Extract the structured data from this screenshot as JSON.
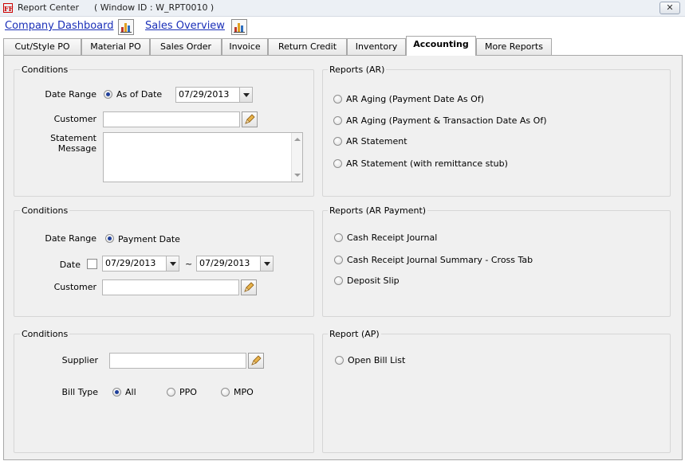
{
  "window": {
    "title": "Report Center",
    "window_id": "( Window ID : W_RPT0010 )",
    "app_icon": "FF",
    "close_icon": "✕"
  },
  "links": {
    "company_dashboard": "Company Dashboard",
    "sales_overview": "Sales Overview",
    "chart_icon": "bar-chart-icon"
  },
  "tabs": [
    {
      "label": "Cut/Style PO"
    },
    {
      "label": "Material PO"
    },
    {
      "label": "Sales Order"
    },
    {
      "label": "Invoice"
    },
    {
      "label": "Return Credit"
    },
    {
      "label": "Inventory"
    },
    {
      "label": "Accounting",
      "active": true
    },
    {
      "label": "More Reports"
    }
  ],
  "ar_conditions": {
    "title": "Conditions",
    "date_range_label": "Date Range",
    "date_range_option": "As of Date",
    "date_value": "07/29/2013",
    "customer_label": "Customer",
    "customer_value": "",
    "statement_label_1": "Statement",
    "statement_label_2": "Message",
    "statement_value": ""
  },
  "ar_reports": {
    "title": "Reports (AR)",
    "items": [
      "AR Aging (Payment Date As Of)",
      "AR Aging (Payment & Transaction Date As Of)",
      "AR Statement",
      "AR Statement (with remittance stub)"
    ]
  },
  "pay_conditions": {
    "title": "Conditions",
    "date_range_label": "Date Range",
    "date_range_option": "Payment Date",
    "date_label": "Date",
    "date_from": "07/29/2013",
    "date_sep": "~",
    "date_to": "07/29/2013",
    "customer_label": "Customer",
    "customer_value": ""
  },
  "pay_reports": {
    "title": "Reports (AR Payment)",
    "items": [
      "Cash Receipt Journal",
      "Cash Receipt Journal Summary - Cross Tab",
      "Deposit Slip"
    ]
  },
  "ap_conditions": {
    "title": "Conditions",
    "supplier_label": "Supplier",
    "supplier_value": "",
    "bill_type_label": "Bill Type",
    "bill_type_options": [
      "All",
      "PPO",
      "MPO"
    ],
    "bill_type_selected": "All"
  },
  "ap_reports": {
    "title": "Report (AP)",
    "items": [
      "Open Bill List"
    ]
  },
  "colors": {
    "link": "#1a2fb8",
    "panel_bg": "#f0f0f0",
    "radio_dot": "#1f3f9a",
    "lookup_icon": "#c98a1a"
  }
}
